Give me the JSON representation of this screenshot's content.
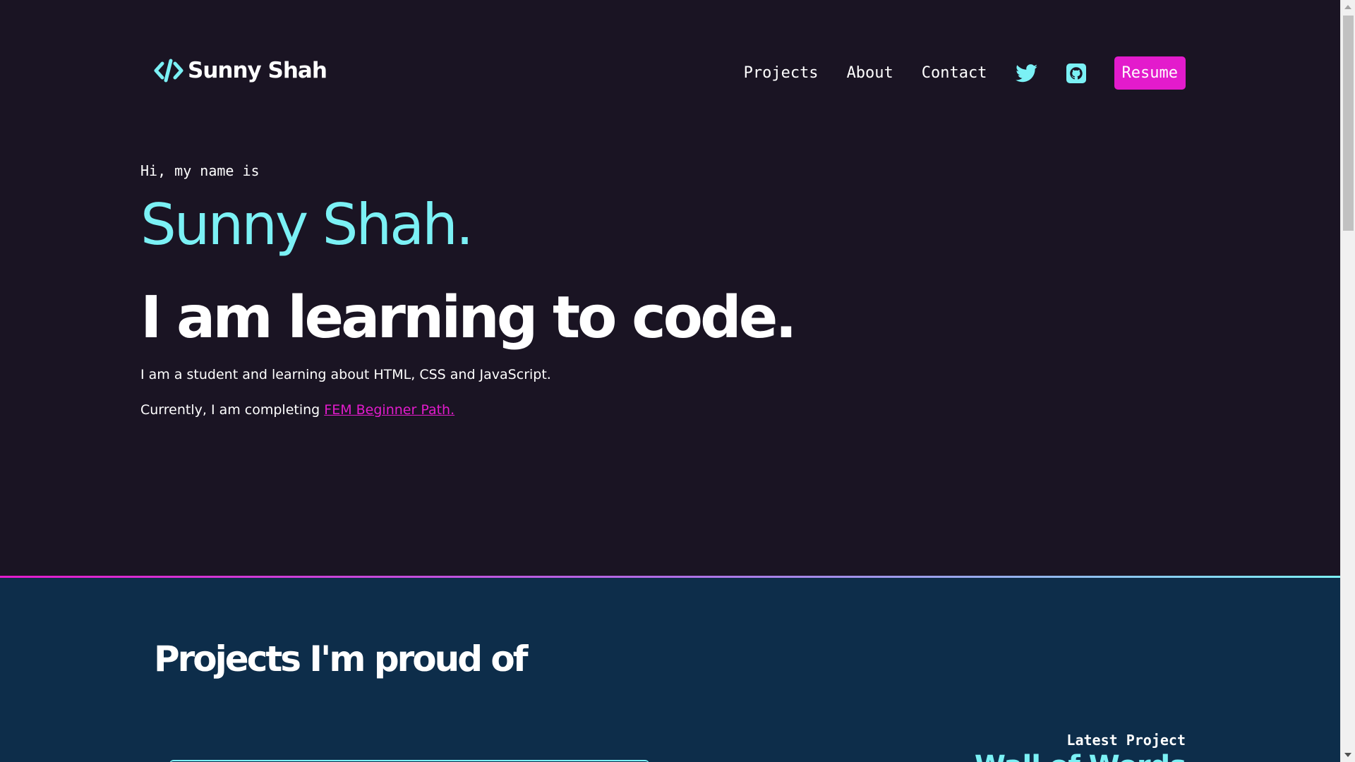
{
  "header": {
    "logo_text": "Sunny Shah",
    "nav": [
      {
        "label": "Projects"
      },
      {
        "label": "About"
      },
      {
        "label": "Contact"
      }
    ],
    "social": [
      {
        "icon": "twitter-icon"
      },
      {
        "icon": "github-icon"
      }
    ],
    "resume_label": "Resume"
  },
  "hero": {
    "greeting": "Hi, my name is",
    "name": "Sunny Shah.",
    "tagline": "I am learning to code.",
    "description": "I am a student and learning about HTML, CSS and JavaScript.",
    "status_prefix": "Currently, I am completing ",
    "status_link": "FEM Beginner Path."
  },
  "projects": {
    "title": "Projects I'm proud of",
    "latest_label": "Latest Project",
    "latest_name": "Wall of Words"
  },
  "colors": {
    "background": "#1a1423",
    "accent_cyan": "#7bf1f5",
    "accent_pink": "#e31bcc",
    "projects_bg": "#0d2d4a"
  }
}
